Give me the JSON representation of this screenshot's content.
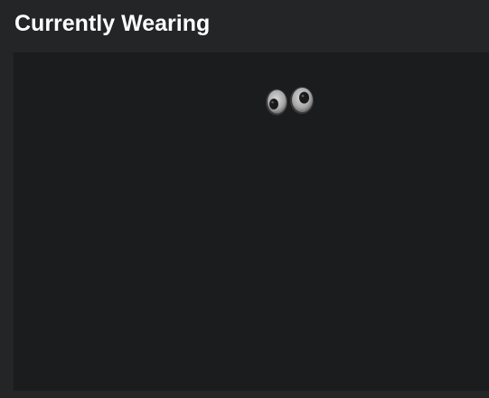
{
  "section": {
    "title": "Currently Wearing"
  },
  "worn_items": [
    {
      "icon": "googly-eyes-icon"
    }
  ],
  "colors": {
    "page_background": "#232527",
    "panel_background": "#1b1c1e",
    "title_text": "#ffffff"
  }
}
